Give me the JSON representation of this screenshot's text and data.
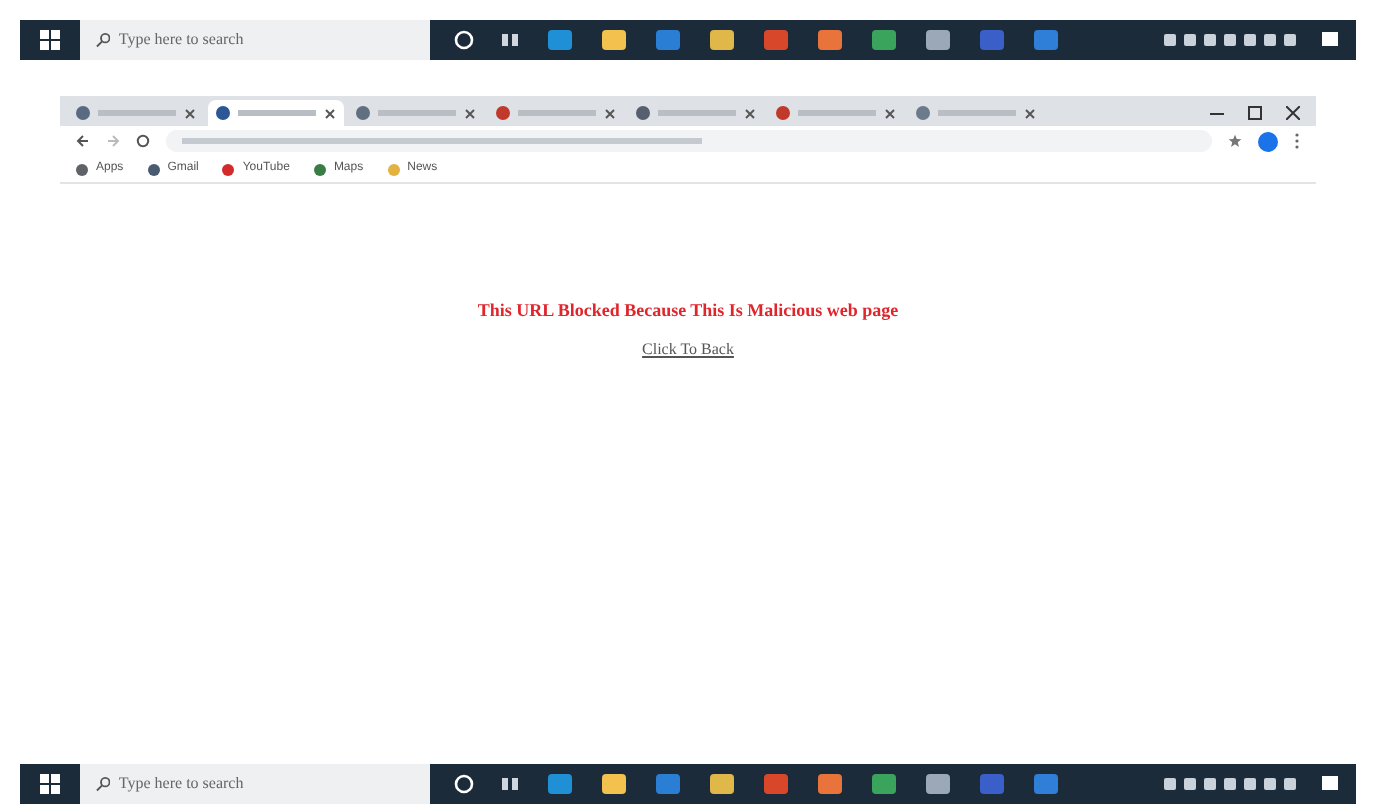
{
  "taskbars": [
    {
      "search": {
        "placeholder": "Type here to search"
      },
      "apps": [
        {
          "color": "#1f8fd6"
        },
        {
          "color": "#f2c14e"
        },
        {
          "color": "#2a7fd4"
        },
        {
          "color": "#e0b84a"
        },
        {
          "color": "#d9472b"
        },
        {
          "color": "#e8743b"
        },
        {
          "color": "#3aa35c"
        },
        {
          "color": "#9aa8b8"
        },
        {
          "color": "#3b5fc9"
        },
        {
          "color": "#2f7fd8"
        }
      ]
    },
    {
      "search": {
        "placeholder": "Type here to search"
      },
      "apps": [
        {
          "color": "#1f8fd6"
        },
        {
          "color": "#f2c14e"
        },
        {
          "color": "#2a7fd4"
        },
        {
          "color": "#e0b84a"
        },
        {
          "color": "#d9472b"
        },
        {
          "color": "#e8743b"
        },
        {
          "color": "#3aa35c"
        },
        {
          "color": "#9aa8b8"
        },
        {
          "color": "#3b5fc9"
        },
        {
          "color": "#2f7fd8"
        }
      ]
    }
  ],
  "browser": {
    "tabs": [
      {
        "selected": false,
        "color": "#5a6a80"
      },
      {
        "selected": true,
        "color": "#2b5797"
      },
      {
        "selected": false,
        "color": "#607080"
      },
      {
        "selected": false,
        "color": "#c0392b"
      },
      {
        "selected": false,
        "color": "#555f6e"
      },
      {
        "selected": false,
        "color": "#c0392b"
      },
      {
        "selected": false,
        "color": "#6b7b8c"
      }
    ],
    "bookmarks": [
      {
        "label": "Apps",
        "color": "#5f6368"
      },
      {
        "label": "Gmail",
        "color": "#4a5a70"
      },
      {
        "label": "YouTube",
        "color": "#d12b2b"
      },
      {
        "label": "Maps",
        "color": "#3a7d44"
      },
      {
        "label": "News",
        "color": "#e3b341"
      }
    ]
  },
  "page": {
    "message": "This URL Blocked Because This Is Malicious web page",
    "link": "Click To Back"
  }
}
